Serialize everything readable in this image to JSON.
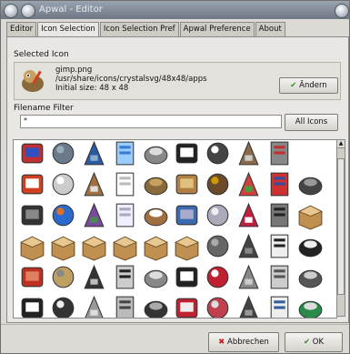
{
  "window": {
    "title": "Apwal - Editor"
  },
  "tabs": [
    "Editor",
    "Icon Selection",
    "Icon Selection Pref",
    "Apwal Preference",
    "About"
  ],
  "selected_icon": {
    "group_label": "Selected Icon",
    "name": "gimp.png",
    "path": "/usr/share/icons/crystalsvg/48x48/apps",
    "size": "Initial size: 48 x 48",
    "change_button": "Ändern"
  },
  "filter": {
    "group_label": "Filename Filter",
    "value": "*",
    "all_icons_button": "All Icons"
  },
  "icons": [
    "crystal-red",
    "monitor",
    "monitor-blue",
    "gear",
    "pencil",
    "notepad-dark",
    "notepad",
    "tools",
    "wrench-red",
    "blank",
    "letter-a",
    "document",
    "hammer-tool",
    "document2",
    "gimp",
    "palette",
    "eagle",
    "colorwheel",
    "disk-flag",
    "gnome-foot",
    "camera-tool",
    "globe",
    "molecule",
    "cd",
    "clipboard",
    "windows",
    "rose-globe",
    "hearts",
    "ball-chain",
    "package",
    "package",
    "package",
    "package",
    "package",
    "package",
    "package",
    "cd-drive",
    "hat",
    "printer",
    "printer",
    "toolbox",
    "folder-pen",
    "speaker",
    "cd-scan",
    "phone",
    "slides",
    "cards",
    "keyboard",
    "calculator",
    "calculator",
    "calculator-dark",
    "calculator-window",
    "keyboard2",
    "calculator3",
    "film",
    "cards2",
    "cards3",
    "film2",
    "window",
    "pen"
  ],
  "buttons": {
    "cancel": "Abbrechen",
    "ok": "OK"
  },
  "colors": {
    "title_bg": "#7d8796",
    "panel": "#e9e7e3",
    "grid_bg": "#ffffff"
  }
}
